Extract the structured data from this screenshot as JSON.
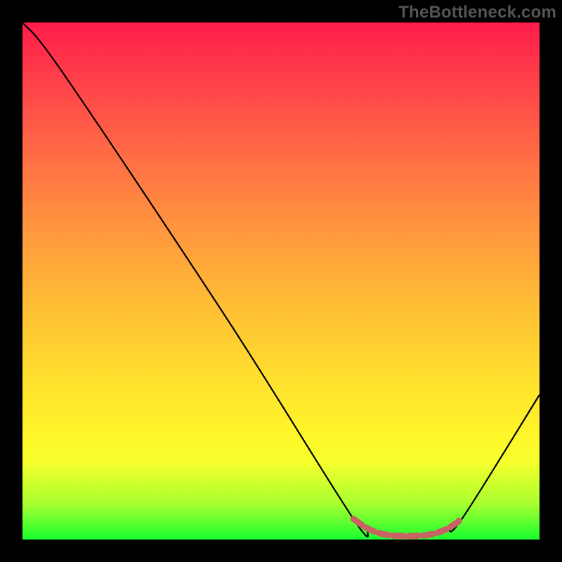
{
  "watermark": "TheBottleneck.com",
  "chart_data": {
    "type": "line",
    "title": "",
    "xlabel": "",
    "ylabel": "",
    "xlim": [
      0,
      100
    ],
    "ylim": [
      0,
      100
    ],
    "series": [
      {
        "name": "bottleneck-curve",
        "x": [
          0,
          8,
          40,
          64,
          67,
          70,
          73,
          76,
          79,
          82,
          85,
          100
        ],
        "values": [
          100,
          90,
          42,
          4,
          2,
          1,
          0.7,
          0.7,
          1,
          2,
          4,
          28
        ]
      },
      {
        "name": "optimal-range-marker",
        "x": [
          64,
          67,
          70,
          73,
          76,
          79,
          82,
          85
        ],
        "values": [
          4,
          2,
          1,
          0.7,
          0.7,
          1,
          2,
          4
        ]
      }
    ],
    "colors": {
      "curve": "#000000",
      "marker": "#c96262",
      "gradient_top": "#ff1b4a",
      "gradient_bottom": "#19ff2f"
    }
  }
}
